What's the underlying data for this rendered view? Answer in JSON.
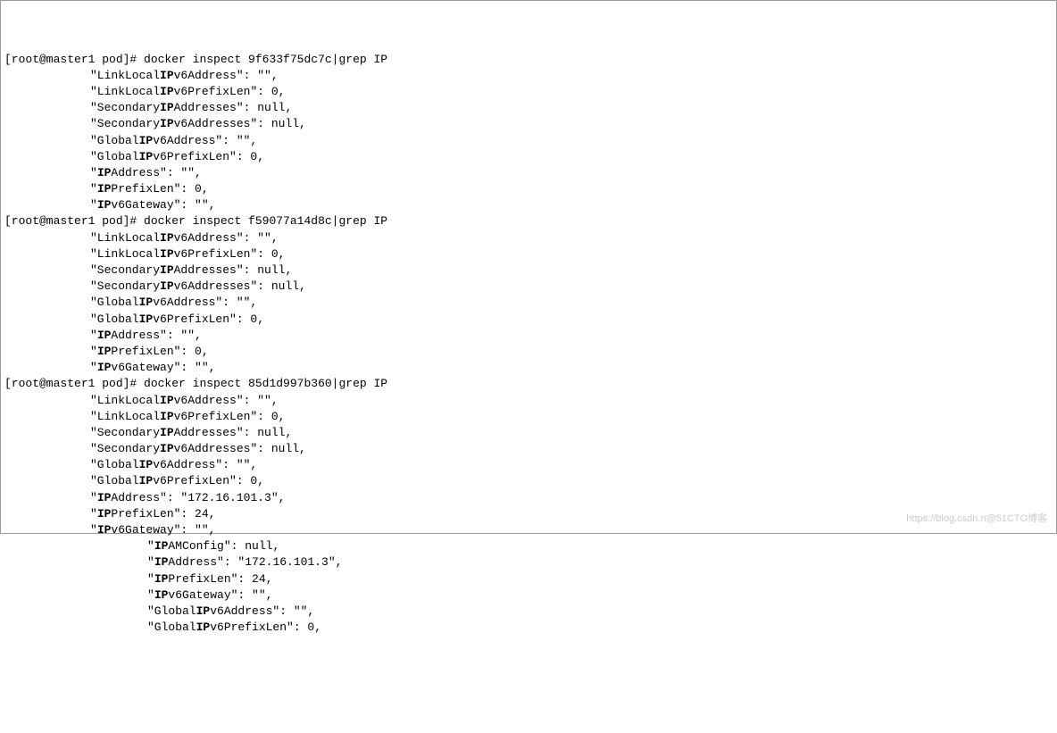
{
  "commands": [
    {
      "prompt": "[root@master1 pod]# ",
      "cmd": "docker inspect 9f633f75dc7c|grep IP",
      "output": [
        {
          "text": "\"LinkLocalIPv6Address\": \"\",",
          "indent": 1
        },
        {
          "text": "\"LinkLocalIPv6PrefixLen\": 0,",
          "indent": 1
        },
        {
          "text": "\"SecondaryIPAddresses\": null,",
          "indent": 1
        },
        {
          "text": "\"SecondaryIPv6Addresses\": null,",
          "indent": 1
        },
        {
          "text": "\"GlobalIPv6Address\": \"\",",
          "indent": 1
        },
        {
          "text": "\"GlobalIPv6PrefixLen\": 0,",
          "indent": 1
        },
        {
          "text": "\"IPAddress\": \"\",",
          "indent": 1
        },
        {
          "text": "\"IPPrefixLen\": 0,",
          "indent": 1
        },
        {
          "text": "\"IPv6Gateway\": \"\",",
          "indent": 1
        }
      ]
    },
    {
      "prompt": "[root@master1 pod]# ",
      "cmd": "docker inspect f59077a14d8c|grep IP",
      "output": [
        {
          "text": "\"LinkLocalIPv6Address\": \"\",",
          "indent": 1
        },
        {
          "text": "\"LinkLocalIPv6PrefixLen\": 0,",
          "indent": 1
        },
        {
          "text": "\"SecondaryIPAddresses\": null,",
          "indent": 1
        },
        {
          "text": "\"SecondaryIPv6Addresses\": null,",
          "indent": 1
        },
        {
          "text": "\"GlobalIPv6Address\": \"\",",
          "indent": 1
        },
        {
          "text": "\"GlobalIPv6PrefixLen\": 0,",
          "indent": 1
        },
        {
          "text": "\"IPAddress\": \"\",",
          "indent": 1
        },
        {
          "text": "\"IPPrefixLen\": 0,",
          "indent": 1
        },
        {
          "text": "\"IPv6Gateway\": \"\",",
          "indent": 1
        }
      ]
    },
    {
      "prompt": "[root@master1 pod]# ",
      "cmd": "docker inspect 85d1d997b360|grep IP",
      "output": [
        {
          "text": "\"LinkLocalIPv6Address\": \"\",",
          "indent": 1
        },
        {
          "text": "\"LinkLocalIPv6PrefixLen\": 0,",
          "indent": 1
        },
        {
          "text": "\"SecondaryIPAddresses\": null,",
          "indent": 1
        },
        {
          "text": "\"SecondaryIPv6Addresses\": null,",
          "indent": 1
        },
        {
          "text": "\"GlobalIPv6Address\": \"\",",
          "indent": 1
        },
        {
          "text": "\"GlobalIPv6PrefixLen\": 0,",
          "indent": 1
        },
        {
          "text": "\"IPAddress\": \"172.16.101.3\",",
          "indent": 1
        },
        {
          "text": "\"IPPrefixLen\": 24,",
          "indent": 1
        },
        {
          "text": "\"IPv6Gateway\": \"\",",
          "indent": 1
        },
        {
          "text": "\"IPAMConfig\": null,",
          "indent": 2
        },
        {
          "text": "\"IPAddress\": \"172.16.101.3\",",
          "indent": 2
        },
        {
          "text": "\"IPPrefixLen\": 24,",
          "indent": 2
        },
        {
          "text": "\"IPv6Gateway\": \"\",",
          "indent": 2
        },
        {
          "text": "\"GlobalIPv6Address\": \"\",",
          "indent": 2
        },
        {
          "text": "\"GlobalIPv6PrefixLen\": 0,",
          "indent": 2
        }
      ]
    }
  ],
  "watermark": "https://blog.csdn.n@51CTO博客"
}
